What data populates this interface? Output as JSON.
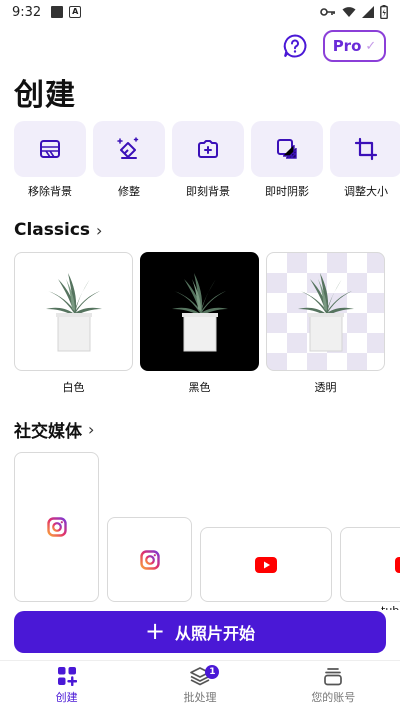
{
  "status_bar": {
    "time": "9:32"
  },
  "header": {
    "pro_label": "Pro",
    "pro_check": "✓",
    "title": "创建"
  },
  "tools": [
    {
      "label": "移除背景",
      "icon": "remove-background-icon"
    },
    {
      "label": "修整",
      "icon": "retouch-icon"
    },
    {
      "label": "即刻背景",
      "icon": "instant-background-icon"
    },
    {
      "label": "即时阴影",
      "icon": "instant-shadow-icon"
    },
    {
      "label": "调整大小",
      "icon": "resize-crop-icon"
    }
  ],
  "classics": {
    "title": "Classics",
    "items": [
      {
        "label": "白色"
      },
      {
        "label": "黑色"
      },
      {
        "label": "透明"
      }
    ]
  },
  "social": {
    "title": "社交媒体",
    "items": [
      {
        "icon": "instagram-icon"
      },
      {
        "icon": "instagram-icon"
      },
      {
        "icon": "youtube-icon"
      },
      {
        "icon": "youtube-icon"
      }
    ],
    "peek_label": "tube"
  },
  "cta": {
    "plus": "+",
    "label": "从照片开始"
  },
  "nav": {
    "items": [
      {
        "label": "创建",
        "active": true
      },
      {
        "label": "批处理",
        "badge": "1"
      },
      {
        "label": "您的账号"
      }
    ]
  },
  "colors": {
    "accent": "#4a18d6",
    "tile_bg": "#f1eefa",
    "pro_border": "#8b3fd8"
  }
}
